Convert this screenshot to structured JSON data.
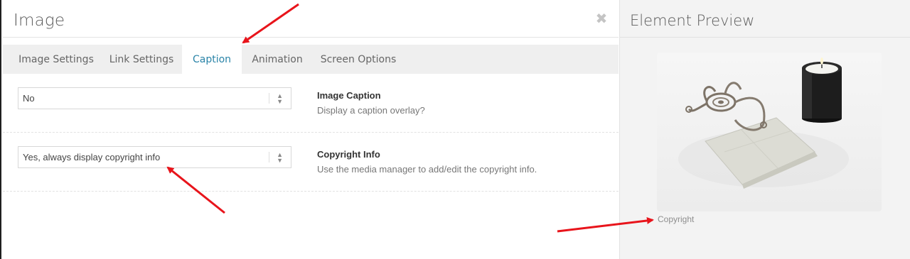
{
  "modal": {
    "title": "Image",
    "close_icon": "close-icon"
  },
  "tabs": [
    {
      "label": "Image Settings"
    },
    {
      "label": "Link Settings"
    },
    {
      "label": "Caption"
    },
    {
      "label": "Animation"
    },
    {
      "label": "Screen Options"
    }
  ],
  "active_tab": "Caption",
  "settings": [
    {
      "value": "No",
      "label": "Image Caption",
      "description": "Display a caption overlay?"
    },
    {
      "value": "Yes, always display copyright info",
      "label": "Copyright Info",
      "description": "Use the media manager to add/edit the copyright info."
    }
  ],
  "preview": {
    "title": "Element Preview",
    "caption": "Copyright"
  },
  "colors": {
    "accent": "#2a84a8",
    "annotation_arrow": "#e8141b"
  }
}
